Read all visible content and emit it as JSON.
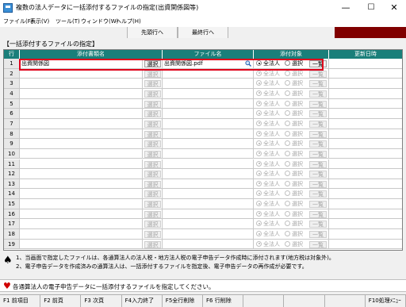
{
  "window": {
    "title": "複数の法人データに一括添付するファイルの指定(出資関係図等)",
    "min": "—",
    "max": "☐",
    "close": "✕"
  },
  "menu": [
    "ファイル(F)",
    "表示(V)",
    "ツール(T)",
    "ウィンドウ(W)",
    "ヘルプ(H)"
  ],
  "toolbar": {
    "first_row": "先頭行へ",
    "last_row": "最終行へ"
  },
  "section_title": "【一括添付するファイルの指定】",
  "table": {
    "headers": {
      "no": "行",
      "name": "添付書類名",
      "file": "ファイル名",
      "target": "添付対象",
      "date": "更新日時"
    },
    "select_label": "選択",
    "list_label": "一覧",
    "radio_all": "全法人",
    "radio_sel": "選択",
    "rows": [
      {
        "no": "1",
        "name": "出資関係図",
        "file": "出資関係図.pdf"
      },
      {
        "no": "2",
        "name": "",
        "file": ""
      },
      {
        "no": "3",
        "name": "",
        "file": ""
      },
      {
        "no": "4",
        "name": "",
        "file": ""
      },
      {
        "no": "5",
        "name": "",
        "file": ""
      },
      {
        "no": "6",
        "name": "",
        "file": ""
      },
      {
        "no": "7",
        "name": "",
        "file": ""
      },
      {
        "no": "8",
        "name": "",
        "file": ""
      },
      {
        "no": "9",
        "name": "",
        "file": ""
      },
      {
        "no": "10",
        "name": "",
        "file": ""
      },
      {
        "no": "11",
        "name": "",
        "file": ""
      },
      {
        "no": "12",
        "name": "",
        "file": ""
      },
      {
        "no": "13",
        "name": "",
        "file": ""
      },
      {
        "no": "14",
        "name": "",
        "file": ""
      },
      {
        "no": "15",
        "name": "",
        "file": ""
      },
      {
        "no": "16",
        "name": "",
        "file": ""
      },
      {
        "no": "17",
        "name": "",
        "file": ""
      },
      {
        "no": "18",
        "name": "",
        "file": ""
      },
      {
        "no": "19",
        "name": "",
        "file": ""
      }
    ]
  },
  "notes": [
    "1、当画面で指定したファイルは、各通算法人の法人税・地方法人税の電子申告データ作成時に添付されます(地方税は対象外)。",
    "2、電子申告データを作成済みの通算法人は、一括添付するファイルを指定後、電子申告データの再作成が必要です。"
  ],
  "guide": "各通算法人の電子申告データに一括添付するファイルを指定してください。",
  "fkeys": [
    "F1 前項目",
    "F2 前頁",
    "F3 次頁",
    "F4入力終了",
    "F5全行削除",
    "F6 行削除",
    "",
    "",
    "",
    "F10処理ﾒﾆｭｰ"
  ],
  "colors": {
    "header_teal": "#1a7f7a",
    "highlight_red": "#e0001b",
    "toolbar_dark_red": "#800000"
  }
}
